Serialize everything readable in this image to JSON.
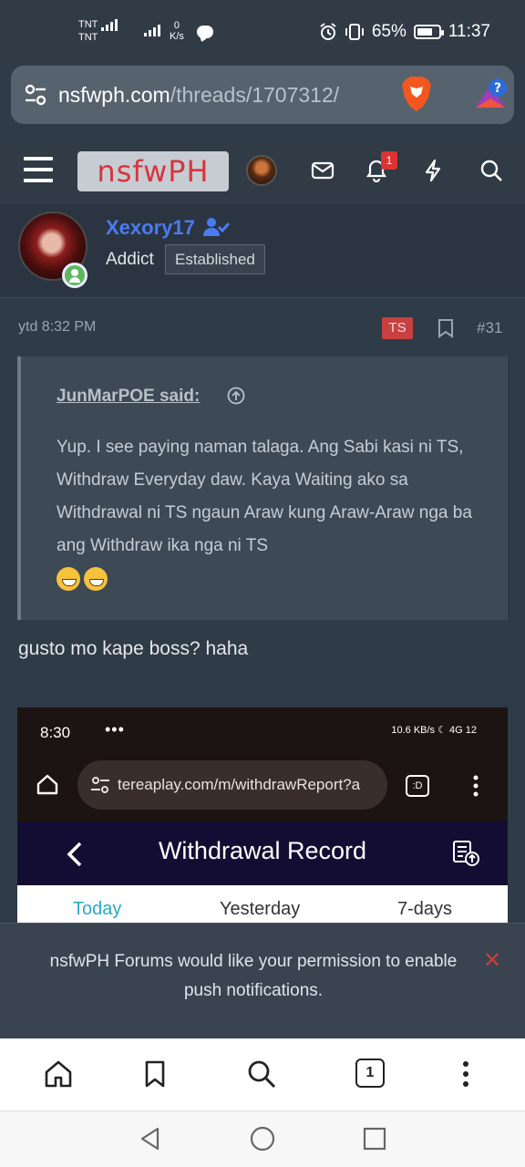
{
  "status_bar": {
    "carrier1": "TNT",
    "carrier2": "TNT",
    "net_speed_value": "0",
    "net_speed_unit": "K/s",
    "battery": "65%",
    "time": "11:37"
  },
  "browser": {
    "url_host": "nsfwph.com",
    "url_path": "/threads/1707312/",
    "tab_count": "1"
  },
  "forum_header": {
    "logo_text": "nsfwPH",
    "notification_count": "1"
  },
  "post": {
    "username": "Xexory17",
    "user_title": "Addict",
    "user_badge": "Established",
    "timestamp": "ytd 8:32 PM",
    "ts_badge": "TS",
    "post_number": "#31",
    "quote": {
      "author": "JunMarPOE said:",
      "text": "Yup. I see paying naman talaga. Ang Sabi kasi ni TS, Withdraw Everyday daw. Kaya Waiting ako sa Withdrawal ni TS ngaun Araw kung Araw-Araw nga ba ang Withdraw ika nga ni TS"
    },
    "reply_text": "gusto mo kape boss? haha"
  },
  "embedded_screenshot": {
    "time": "8:30",
    "dots": "•••",
    "status_right": "10.6 KB/s  ☾  4G  12",
    "url": "tereaplay.com/m/withdrawReport?a",
    "tabs_label": ":D",
    "title": "Withdrawal Record",
    "tabs": [
      "Today",
      "Yesterday",
      "7-days"
    ],
    "active_tab_color": "#2aa7c9"
  },
  "permission_banner": {
    "text": "nsfwPH Forums would like your permission to enable push notifications.",
    "close": "✕"
  },
  "colors": {
    "accent_username": "#4b7bf0",
    "logo_red": "#d6363f",
    "badge_red": "#c84040"
  }
}
